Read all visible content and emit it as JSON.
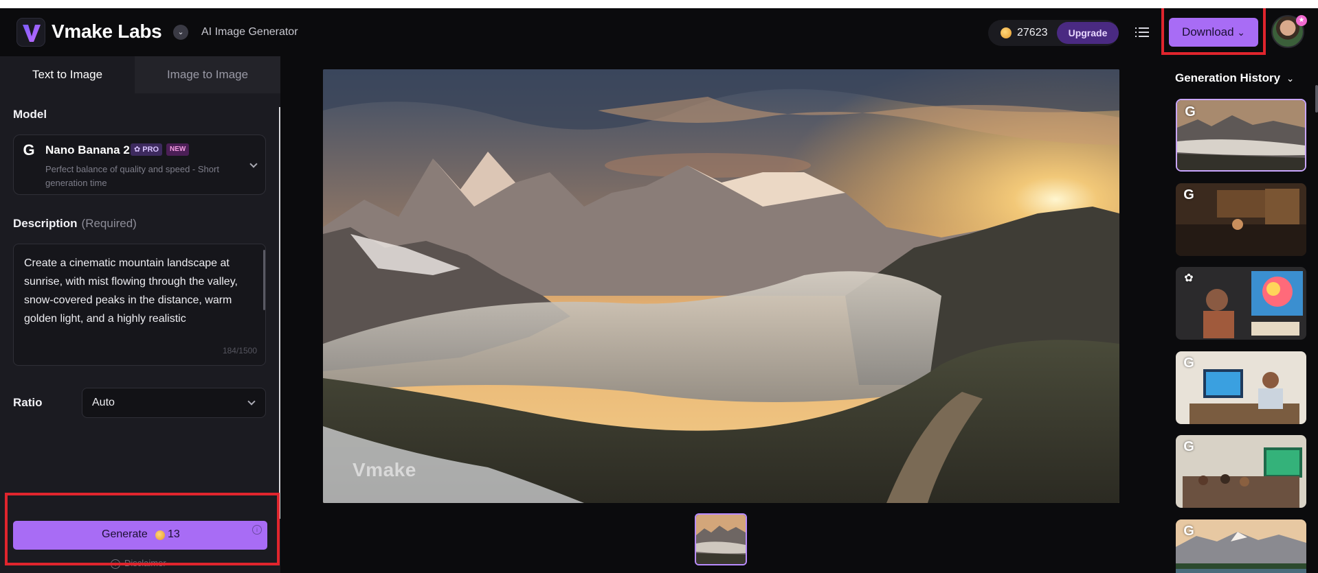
{
  "header": {
    "brand_name": "Vmake Labs",
    "subtitle": "AI Image Generator",
    "credits": "27623",
    "upgrade_label": "Upgrade",
    "download_label": "Download",
    "icons": [
      "vmake-logo-icon",
      "chevron-down-icon",
      "coin-icon",
      "menu-list-icon",
      "avatar",
      "star-badge-icon"
    ]
  },
  "left_panel": {
    "tabs": [
      {
        "label": "Text to Image",
        "active": true
      },
      {
        "label": "Image to Image",
        "active": false
      }
    ],
    "model_label": "Model",
    "model": {
      "name": "Nano Banana 2",
      "badge_pro": "✿ PRO",
      "badge_new": "NEW",
      "description": "Perfect balance of quality and speed - Short generation time"
    },
    "description_label": "Description",
    "description_required": "(Required)",
    "description_text": "Create a cinematic mountain landscape at sunrise, with mist flowing through the valley, snow-covered peaks in the distance, warm golden light, and a highly realistic",
    "char_count": "184/1500",
    "ratio_label": "Ratio",
    "ratio_value": "Auto",
    "generate_label": "Generate",
    "generate_cost": "13",
    "disclaimer": "Disclaimer"
  },
  "preview": {
    "watermark": "Vmake"
  },
  "history": {
    "title": "Generation History",
    "items": [
      {
        "logo": "G",
        "subject": "mountain sunrise mist",
        "selected": true
      },
      {
        "logo": "G",
        "subject": "cafe interior",
        "selected": false
      },
      {
        "logo": "openai-icon",
        "subject": "woman painting colorful portrait",
        "selected": false
      },
      {
        "logo": "G",
        "subject": "woman at computer desk",
        "selected": false
      },
      {
        "logo": "G",
        "subject": "classroom with screen",
        "selected": false
      },
      {
        "logo": "G",
        "subject": "mountain lake",
        "selected": false
      }
    ]
  },
  "colors": {
    "accent": "#a86cf5",
    "background": "#0b0b0d",
    "panel": "#1b1b21",
    "highlight": "#e0252d"
  }
}
